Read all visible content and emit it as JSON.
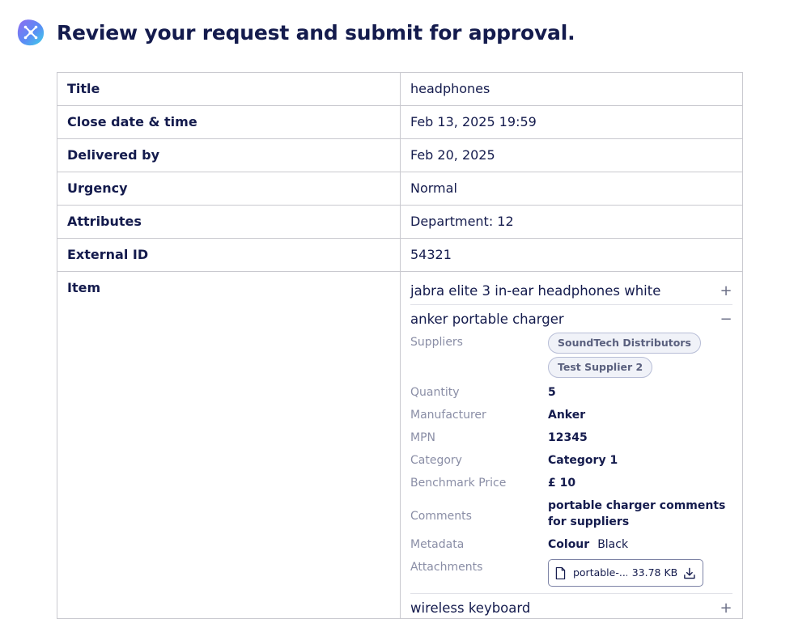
{
  "page": {
    "title": "Review your request and submit for approval."
  },
  "fields": [
    {
      "label": "Title",
      "value": "headphones"
    },
    {
      "label": "Close date & time",
      "value": "Feb 13, 2025 19:59"
    },
    {
      "label": "Delivered by",
      "value": "Feb 20, 2025"
    },
    {
      "label": "Urgency",
      "value": "Normal"
    },
    {
      "label": "Attributes",
      "value": "Department: 12"
    },
    {
      "label": "External ID",
      "value": "54321"
    }
  ],
  "item_label": "Item",
  "items": [
    {
      "name": "jabra elite 3 in-ear headphones white",
      "toggle": "+"
    },
    {
      "name": "anker portable charger",
      "toggle": "−"
    },
    {
      "name": "wireless keyboard",
      "toggle": "+"
    }
  ],
  "details": {
    "suppliers_label": "Suppliers",
    "suppliers": [
      "SoundTech Distributors",
      "Test Supplier 2"
    ],
    "quantity_label": "Quantity",
    "quantity": "5",
    "manufacturer_label": "Manufacturer",
    "manufacturer": "Anker",
    "mpn_label": "MPN",
    "mpn": "12345",
    "category_label": "Category",
    "category": "Category 1",
    "benchmark_label": "Benchmark Price",
    "benchmark": "£ 10",
    "comments_label": "Comments",
    "comments": "portable charger comments for suppliers",
    "metadata_label": "Metadata",
    "metadata_key": "Colour",
    "metadata_value": "Black",
    "attachments_label": "Attachments",
    "attachment_name": "portable-...",
    "attachment_size": "33.78 KB"
  },
  "colors": {
    "text": "#141b4d",
    "muted": "#8a8ea6",
    "border": "#c9c9cf",
    "chip_bg": "#f0f2f8"
  },
  "icons": [
    "app-logo-icon",
    "plus-icon",
    "minus-icon",
    "file-icon",
    "download-icon"
  ]
}
